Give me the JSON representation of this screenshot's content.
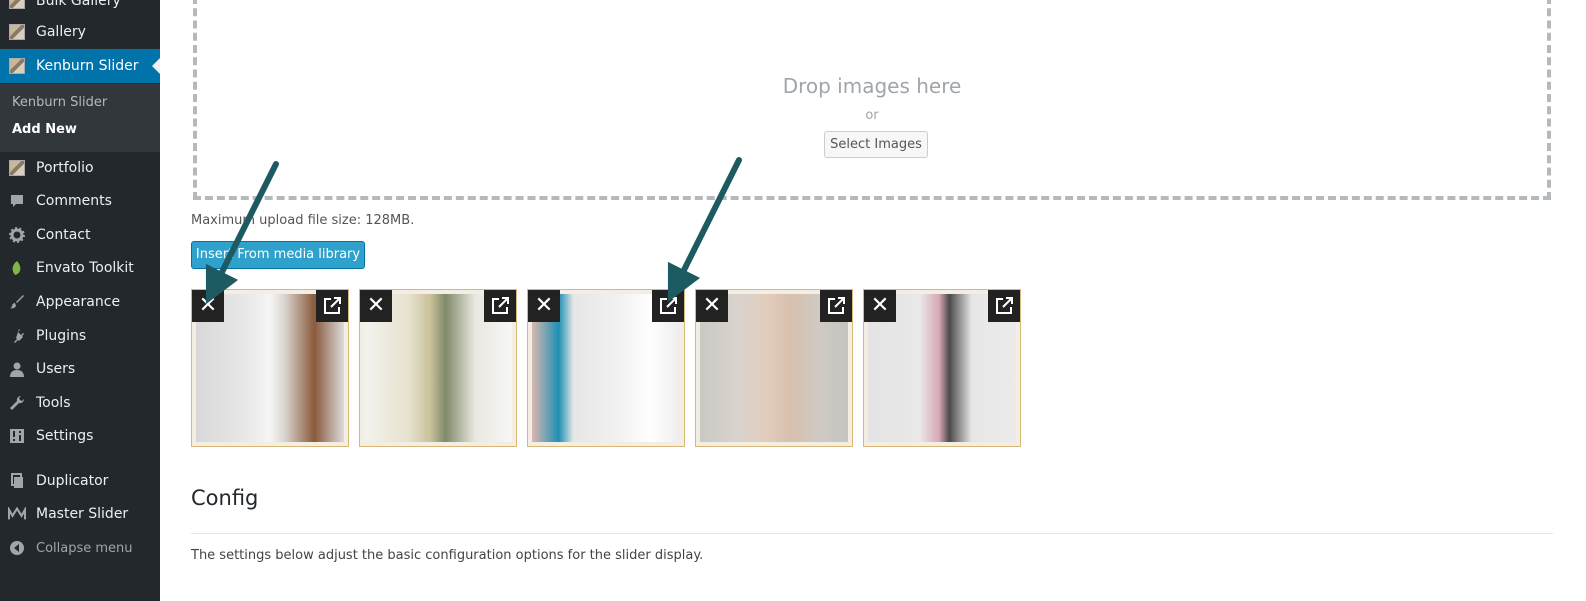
{
  "sidebar": {
    "items": [
      {
        "label": "Bulk Gallery",
        "icon": "bulk-gallery-icon"
      },
      {
        "label": "Gallery",
        "icon": "gallery-icon"
      },
      {
        "label": "Kenburn Slider",
        "icon": "kenburn-slider-icon",
        "active": true
      },
      {
        "label": "Portfolio",
        "icon": "portfolio-icon"
      },
      {
        "label": "Comments",
        "icon": "comments-icon"
      },
      {
        "label": "Contact",
        "icon": "gear-icon"
      },
      {
        "label": "Envato Toolkit",
        "icon": "leaf-icon"
      },
      {
        "label": "Appearance",
        "icon": "paintbrush-icon"
      },
      {
        "label": "Plugins",
        "icon": "plug-icon"
      },
      {
        "label": "Users",
        "icon": "user-icon"
      },
      {
        "label": "Tools",
        "icon": "wrench-icon"
      },
      {
        "label": "Settings",
        "icon": "sliders-icon"
      },
      {
        "label": "Duplicator",
        "icon": "duplicator-icon"
      },
      {
        "label": "Master Slider",
        "icon": "master-slider-icon"
      }
    ],
    "submenu": [
      {
        "label": "Kenburn Slider"
      },
      {
        "label": "Add New",
        "current": true
      }
    ],
    "collapse_label": "Collapse menu"
  },
  "upload": {
    "drop_text": "Drop images here",
    "or_text": "or",
    "select_button": "Select Images",
    "max_size": "Maximum upload file size: 128MB.",
    "insert_button": "Insert From media library"
  },
  "thumbnails": [
    {
      "delete_icon": "close-icon",
      "open_icon": "external-link-icon"
    },
    {
      "delete_icon": "close-icon",
      "open_icon": "external-link-icon"
    },
    {
      "delete_icon": "close-icon",
      "open_icon": "external-link-icon"
    },
    {
      "delete_icon": "close-icon",
      "open_icon": "external-link-icon"
    },
    {
      "delete_icon": "close-icon",
      "open_icon": "external-link-icon"
    }
  ],
  "config": {
    "title": "Config",
    "description": "The settings below adjust the basic configuration options for the slider display."
  },
  "colors": {
    "sidebar_bg": "#23282d",
    "active_bg": "#0073aa",
    "insert_button": "#2ea2cc",
    "arrow": "#1d5a62",
    "thumb_border": "#d5b77a"
  }
}
